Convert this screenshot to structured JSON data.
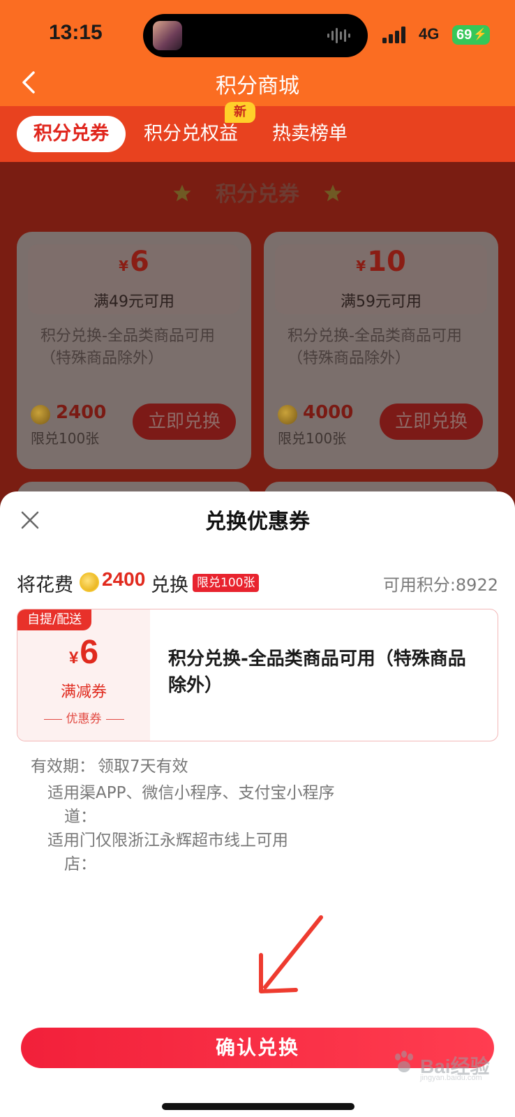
{
  "status_bar": {
    "time": "13:15",
    "network": "4G",
    "battery": "69"
  },
  "nav": {
    "title": "积分商城"
  },
  "tabs": [
    {
      "label": "积分兑券",
      "active": true
    },
    {
      "label": "积分兑权益",
      "badge": "新"
    },
    {
      "label": "热卖榜单"
    }
  ],
  "section": {
    "title": "积分兑券"
  },
  "cards": [
    {
      "yen": "¥",
      "amount": "6",
      "condition": "满49元可用",
      "description": "积分兑换-全品类商品可用（特殊商品除外）",
      "points": "2400",
      "limit": "限兑100张",
      "button": "立即兑换"
    },
    {
      "yen": "¥",
      "amount": "10",
      "condition": "满59元可用",
      "description": "积分兑换-全品类商品可用（特殊商品除外）",
      "points": "4000",
      "limit": "限兑100张",
      "button": "立即兑换"
    }
  ],
  "sheet": {
    "title": "兑换优惠券",
    "spend_prefix": "将花费",
    "spend_points": "2400",
    "spend_suffix": "兑换",
    "limit_badge": "限兑100张",
    "available": "可用积分:8922",
    "coupon": {
      "tag": "自提/配送",
      "yen": "¥",
      "amount": "6",
      "type": "满减券",
      "sub": "优惠券",
      "description": "积分兑换-全品类商品可用（特殊商品除外）"
    },
    "validity_label": "有效期：",
    "validity_value": "领取7天有效",
    "channel_label_1": "适用渠",
    "channel_label_2": "道：",
    "channel_value": "APP、微信小程序、支付宝小程序",
    "store_label_1": "适用门",
    "store_label_2": "店：",
    "store_value": "仅限浙江永辉超市线上可用",
    "confirm_button": "确认兑换"
  },
  "watermark": {
    "text": "Bai经验",
    "sub": "jingyan.baidu.com"
  },
  "colors": {
    "brand_orange": "#fb6d22",
    "accent_red": "#e02a1e",
    "confirm_red": "#f2203a"
  }
}
